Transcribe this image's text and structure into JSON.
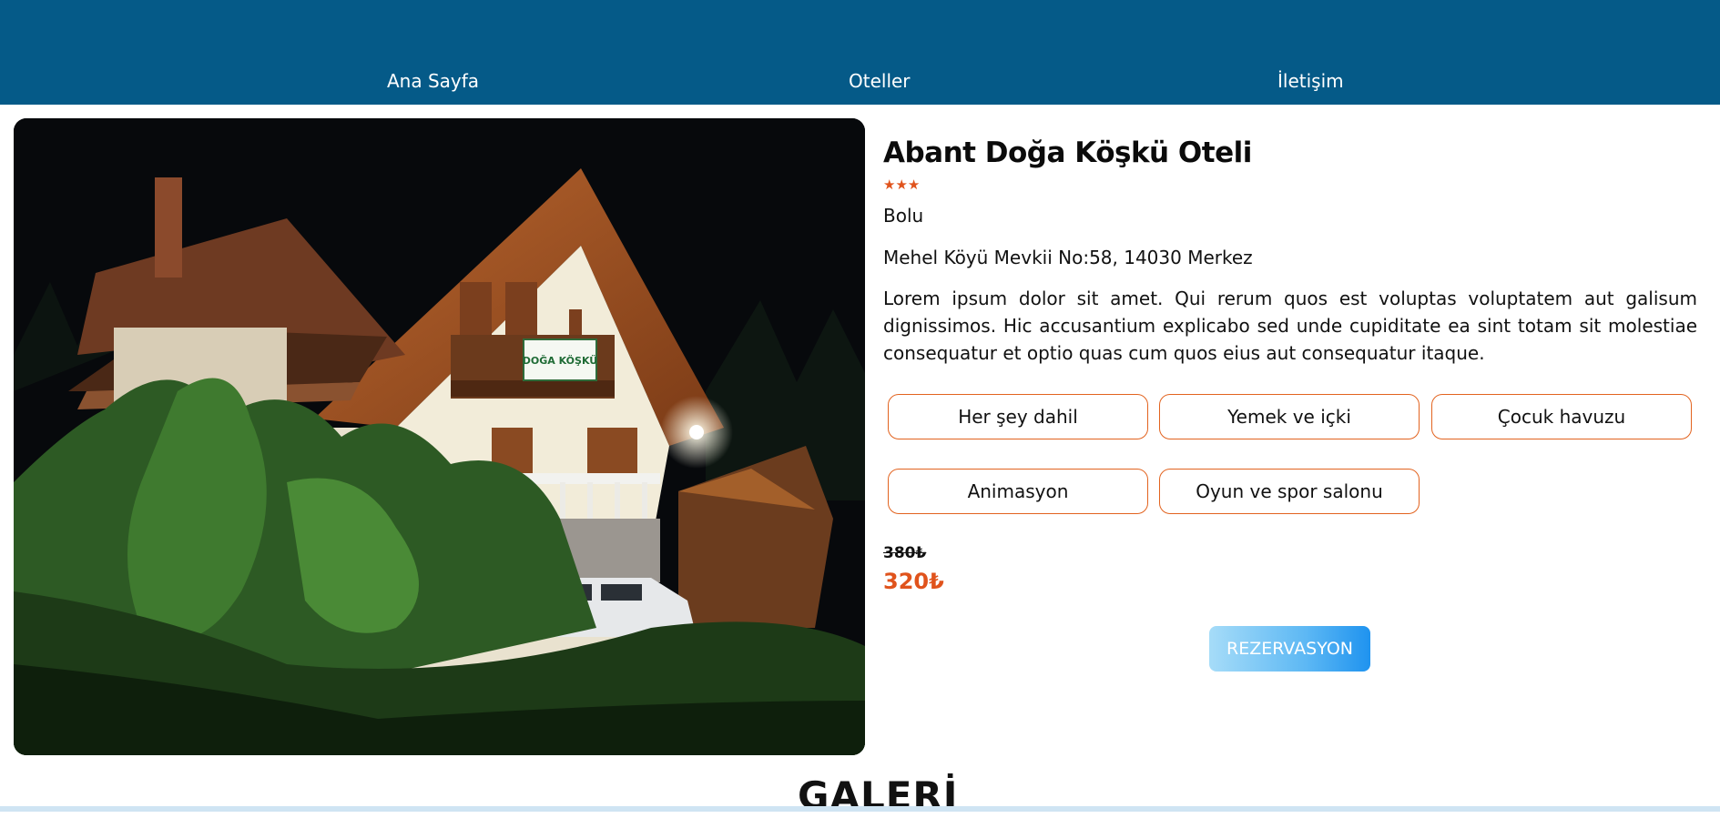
{
  "nav": {
    "home": "Ana Sayfa",
    "hotels": "Oteller",
    "contact": "İletişim"
  },
  "hotel": {
    "photo_sign": "DOĞA KÖŞKÜ",
    "name": "Abant Doğa Köşkü Oteli",
    "stars": "★★★",
    "star_count": 3,
    "city": "Bolu",
    "address": "Mehel Köyü Mevkii No:58, 14030 Merkez",
    "description": "Lorem ipsum dolor sit amet. Qui rerum quos est voluptas voluptatem aut galisum dignissimos. Hic accusantium explicabo sed unde cupiditate ea sint totam sit molestiae consequatur et optio quas cum quos eius aut consequatur itaque.",
    "features": [
      "Her şey dahil",
      "Yemek ve içki",
      "Çocuk havuzu",
      "Animasyon",
      "Oyun ve spor salonu"
    ],
    "old_price": "380₺",
    "new_price": "320₺",
    "reserve_label": "REZERVASYON"
  },
  "gallery": {
    "title": "GALERİ"
  },
  "colors": {
    "header": "#055a88",
    "accent": "#e0531c",
    "feature_border": "#e2631f",
    "button_start": "#a6dcf8",
    "button_end": "#1f93ef"
  }
}
